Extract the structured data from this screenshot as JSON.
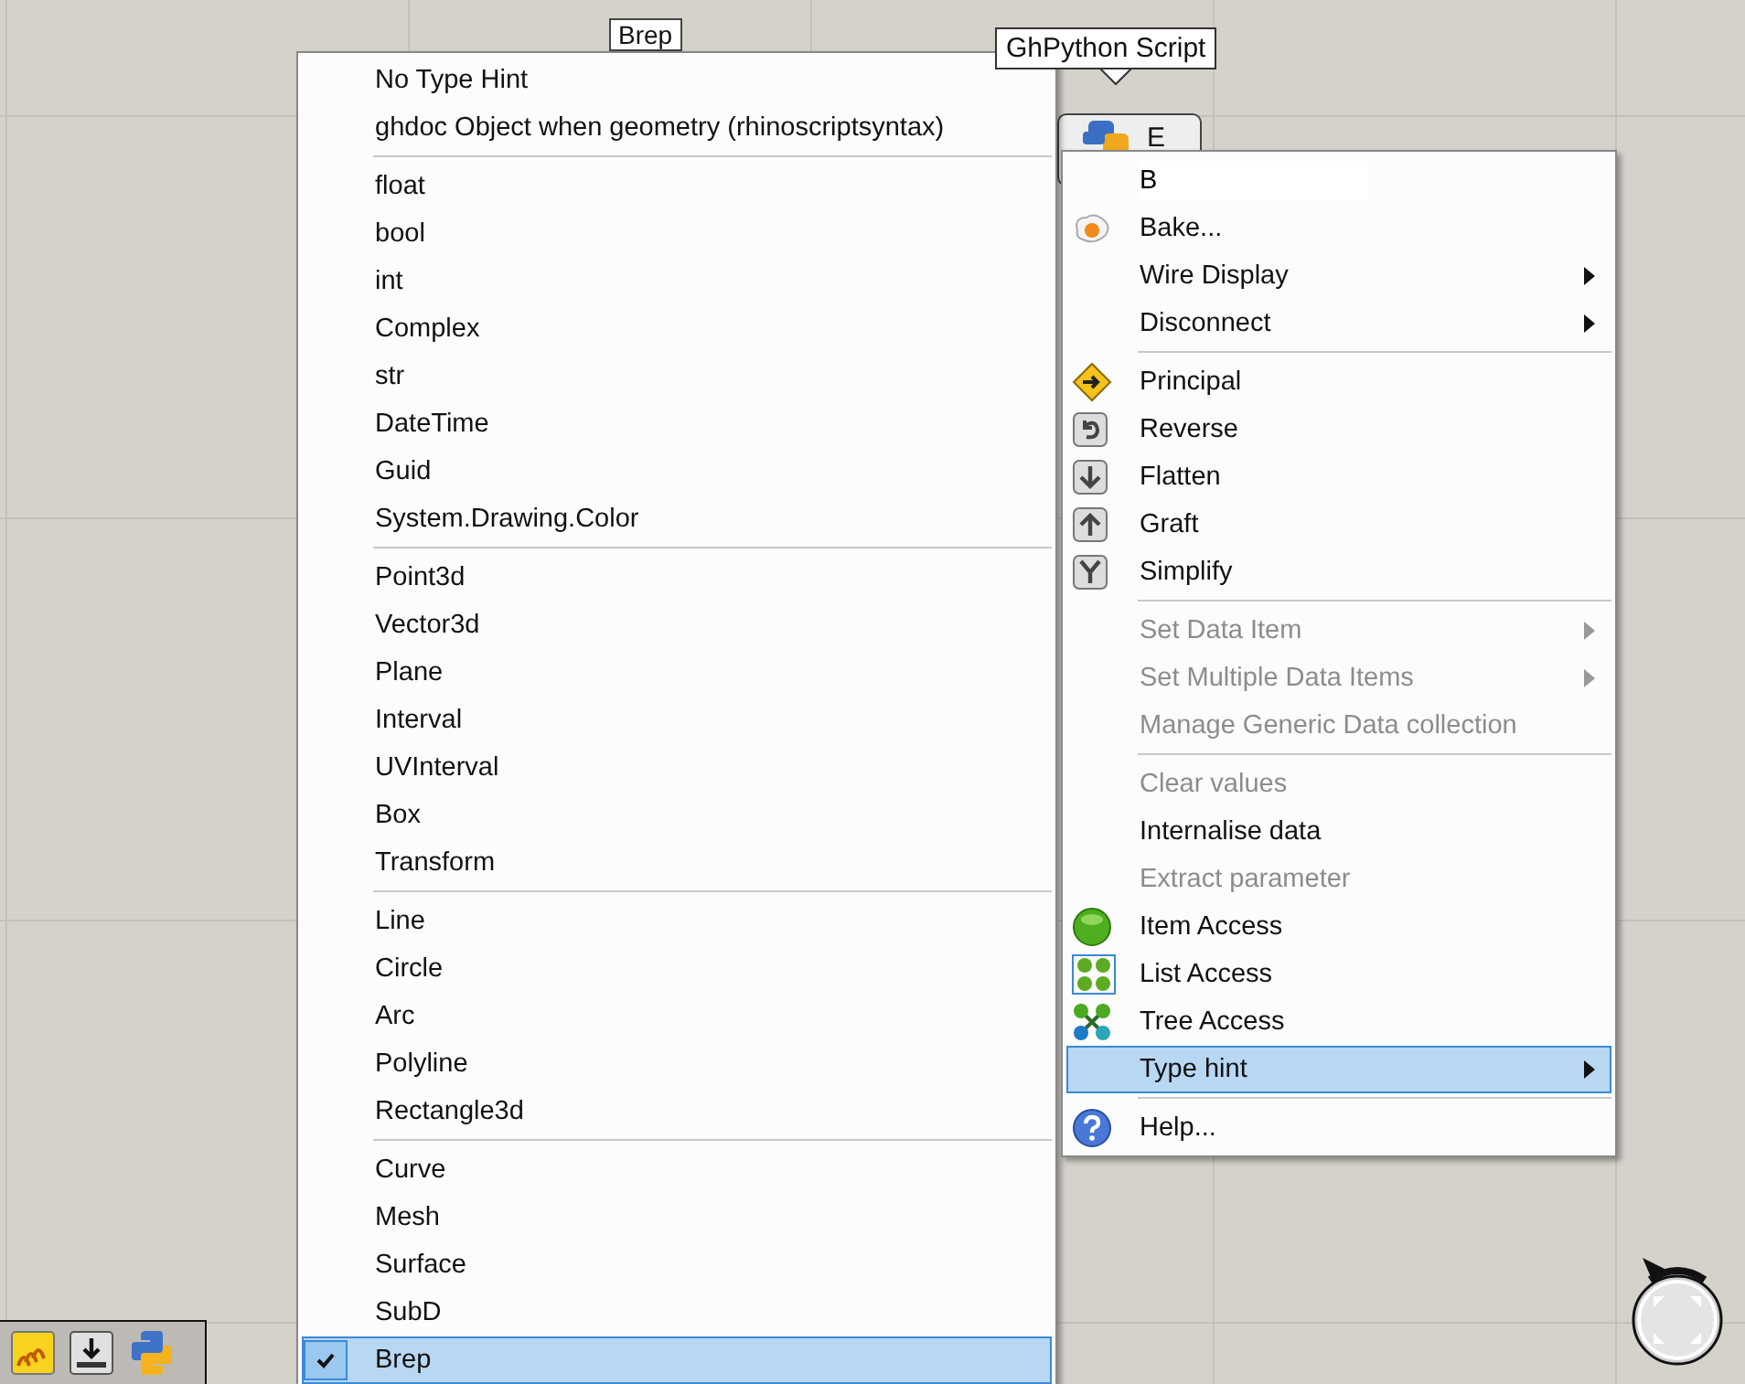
{
  "canvas": {
    "parameter_label": "Brep",
    "tooltip": "GhPython Script",
    "component_output": "E"
  },
  "type_hint_menu": {
    "groups": [
      [
        {
          "label": "No Type Hint",
          "checked": false,
          "selected": false
        },
        {
          "label": "ghdoc Object when geometry (rhinoscriptsyntax)",
          "checked": false,
          "selected": false
        }
      ],
      [
        {
          "label": "float",
          "checked": false,
          "selected": false
        },
        {
          "label": "bool",
          "checked": false,
          "selected": false
        },
        {
          "label": "int",
          "checked": false,
          "selected": false
        },
        {
          "label": "Complex",
          "checked": false,
          "selected": false
        },
        {
          "label": "str",
          "checked": false,
          "selected": false
        },
        {
          "label": "DateTime",
          "checked": false,
          "selected": false
        },
        {
          "label": "Guid",
          "checked": false,
          "selected": false
        },
        {
          "label": "System.Drawing.Color",
          "checked": false,
          "selected": false
        }
      ],
      [
        {
          "label": "Point3d",
          "checked": false,
          "selected": false
        },
        {
          "label": "Vector3d",
          "checked": false,
          "selected": false
        },
        {
          "label": "Plane",
          "checked": false,
          "selected": false
        },
        {
          "label": "Interval",
          "checked": false,
          "selected": false
        },
        {
          "label": "UVInterval",
          "checked": false,
          "selected": false
        },
        {
          "label": "Box",
          "checked": false,
          "selected": false
        },
        {
          "label": "Transform",
          "checked": false,
          "selected": false
        }
      ],
      [
        {
          "label": "Line",
          "checked": false,
          "selected": false
        },
        {
          "label": "Circle",
          "checked": false,
          "selected": false
        },
        {
          "label": "Arc",
          "checked": false,
          "selected": false
        },
        {
          "label": "Polyline",
          "checked": false,
          "selected": false
        },
        {
          "label": "Rectangle3d",
          "checked": false,
          "selected": false
        }
      ],
      [
        {
          "label": "Curve",
          "checked": false,
          "selected": false
        },
        {
          "label": "Mesh",
          "checked": false,
          "selected": false
        },
        {
          "label": "Surface",
          "checked": false,
          "selected": false
        },
        {
          "label": "SubD",
          "checked": false,
          "selected": false
        },
        {
          "label": "Brep",
          "checked": true,
          "selected": true
        }
      ]
    ]
  },
  "context_menu": {
    "items": [
      {
        "kind": "name_field",
        "value": "B"
      },
      {
        "kind": "item",
        "label": "Bake...",
        "disabled": false,
        "submenu": false,
        "selected": false
      },
      {
        "kind": "item",
        "label": "Wire Display",
        "disabled": false,
        "submenu": true,
        "selected": false
      },
      {
        "kind": "item",
        "label": "Disconnect",
        "disabled": false,
        "submenu": true,
        "selected": false
      },
      {
        "kind": "separator"
      },
      {
        "kind": "item",
        "label": "Principal",
        "disabled": false,
        "submenu": false,
        "selected": false
      },
      {
        "kind": "item",
        "label": "Reverse",
        "disabled": false,
        "submenu": false,
        "selected": false
      },
      {
        "kind": "item",
        "label": "Flatten",
        "disabled": false,
        "submenu": false,
        "selected": false
      },
      {
        "kind": "item",
        "label": "Graft",
        "disabled": false,
        "submenu": false,
        "selected": false
      },
      {
        "kind": "item",
        "label": "Simplify",
        "disabled": false,
        "submenu": false,
        "selected": false
      },
      {
        "kind": "separator"
      },
      {
        "kind": "item",
        "label": "Set Data Item",
        "disabled": true,
        "submenu": true,
        "selected": false
      },
      {
        "kind": "item",
        "label": "Set Multiple Data Items",
        "disabled": true,
        "submenu": true,
        "selected": false
      },
      {
        "kind": "item",
        "label": "Manage Generic Data collection",
        "disabled": true,
        "submenu": false,
        "selected": false
      },
      {
        "kind": "separator"
      },
      {
        "kind": "item",
        "label": "Clear values",
        "disabled": true,
        "submenu": false,
        "selected": false
      },
      {
        "kind": "item",
        "label": "Internalise data",
        "disabled": false,
        "submenu": false,
        "selected": false
      },
      {
        "kind": "item",
        "label": "Extract parameter",
        "disabled": true,
        "submenu": false,
        "selected": false
      },
      {
        "kind": "item",
        "label": "Item Access",
        "disabled": false,
        "submenu": false,
        "selected": false
      },
      {
        "kind": "item",
        "label": "List Access",
        "disabled": false,
        "submenu": false,
        "selected": false
      },
      {
        "kind": "item",
        "label": "Tree Access",
        "disabled": false,
        "submenu": false,
        "selected": false
      },
      {
        "kind": "item",
        "label": "Type hint",
        "disabled": false,
        "submenu": true,
        "selected": true
      },
      {
        "kind": "separator"
      },
      {
        "kind": "item",
        "label": "Help...",
        "disabled": false,
        "submenu": false,
        "selected": false
      }
    ]
  }
}
